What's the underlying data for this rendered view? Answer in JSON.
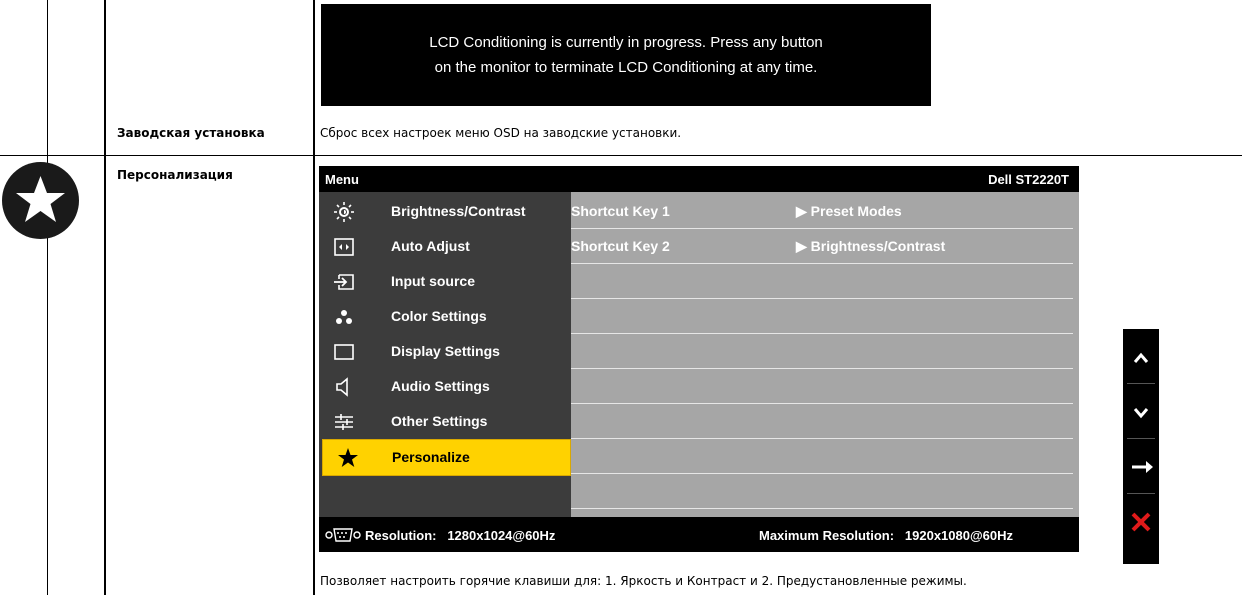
{
  "lcd_banner": {
    "line1": "LCD Conditioning is currently in progress. Press any button",
    "line2": "on the monitor to terminate LCD Conditioning at any time."
  },
  "rows": [
    {
      "label": "Заводская установка",
      "description": "Сброс всех настроек меню OSD на заводские установки."
    },
    {
      "label": "Персонализация",
      "description": "Позволяет настроить горячие клавиши для: 1. Яркость и Контраст и 2. Предустановленные режимы."
    }
  ],
  "osd": {
    "header_left": "Menu",
    "header_right": "Dell ST2220T",
    "menu_items": [
      {
        "label": "Brightness/Contrast",
        "icon": "brightness-icon"
      },
      {
        "label": "Auto Adjust",
        "icon": "auto-adjust-icon"
      },
      {
        "label": "Input source",
        "icon": "input-source-icon"
      },
      {
        "label": "Color Settings",
        "icon": "color-settings-icon"
      },
      {
        "label": "Display Settings",
        "icon": "display-settings-icon"
      },
      {
        "label": "Audio Settings",
        "icon": "audio-settings-icon"
      },
      {
        "label": "Other Settings",
        "icon": "other-settings-icon"
      },
      {
        "label": "Personalize",
        "icon": "star-icon",
        "selected": true
      }
    ],
    "settings": [
      {
        "key": "Shortcut Key 1",
        "value": "Preset Modes"
      },
      {
        "key": "Shortcut Key 2",
        "value": "Brightness/Contrast"
      }
    ],
    "footer_resolution": "Resolution:   1280x1024@60Hz",
    "footer_max_resolution": "Maximum Resolution:   1920x1080@60Hz",
    "value_arrow": "▶"
  },
  "side_nav": {
    "up": "up-arrow-icon",
    "down": "down-arrow-icon",
    "enter": "enter-arrow-icon",
    "exit": "close-icon",
    "exit_color": "#e01a1a"
  },
  "colors": {
    "highlight": "#ffd200",
    "panel_right": "#a6a6a6",
    "panel_left": "#3c3c3c"
  }
}
